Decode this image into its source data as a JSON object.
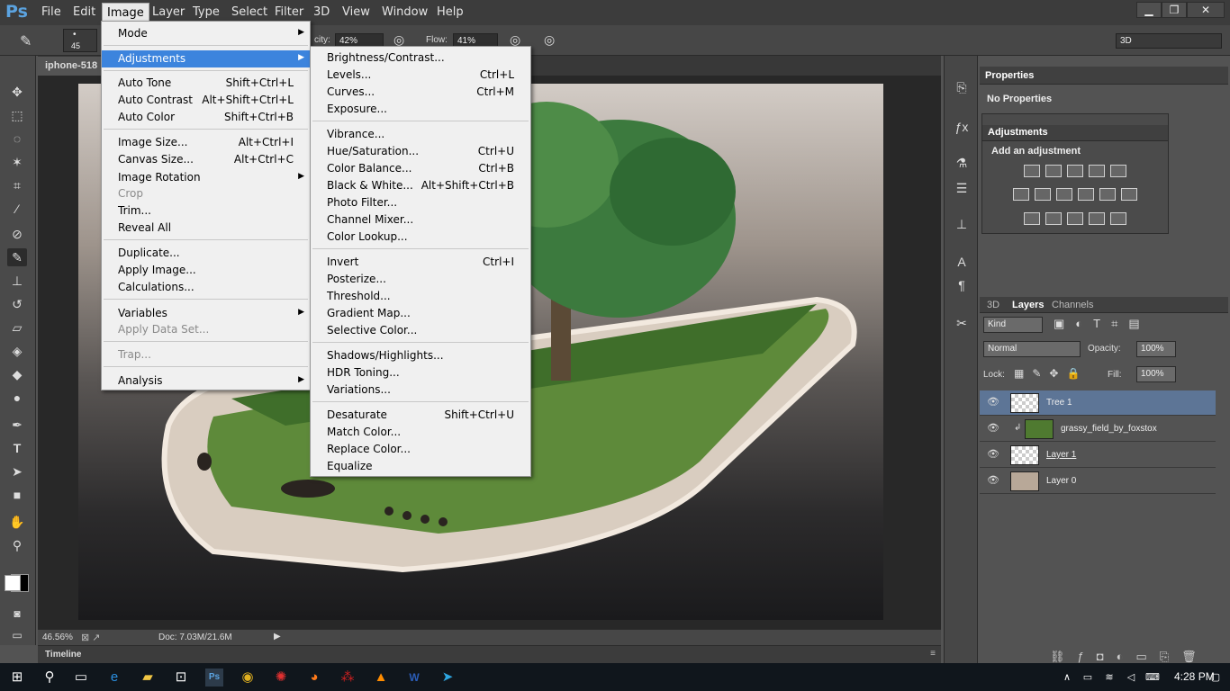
{
  "menubar": {
    "logo": "Ps",
    "items": [
      "File",
      "Edit",
      "Image",
      "Layer",
      "Type",
      "Select",
      "Filter",
      "3D",
      "View",
      "Window",
      "Help"
    ],
    "active": "Image"
  },
  "options": {
    "brush_size": "45",
    "opacity_label": "city:",
    "opacity_value": "42%",
    "flow_label": "Flow:",
    "flow_value": "41%",
    "workspace": "3D"
  },
  "document": {
    "tab_title": "iphone-518",
    "zoom": "46.56%",
    "doc_info": "Doc: 7.03M/21.6M"
  },
  "timeline": {
    "label": "Timeline"
  },
  "image_menu": {
    "items": [
      {
        "label": "Mode",
        "shortcut": "",
        "submenu": true
      },
      {
        "label": "Adjustments",
        "shortcut": "",
        "submenu": true,
        "highlighted": true
      },
      {
        "label": "Auto Tone",
        "shortcut": "Shift+Ctrl+L"
      },
      {
        "label": "Auto Contrast",
        "shortcut": "Alt+Shift+Ctrl+L"
      },
      {
        "label": "Auto Color",
        "shortcut": "Shift+Ctrl+B"
      },
      {
        "label": "Image Size...",
        "shortcut": "Alt+Ctrl+I"
      },
      {
        "label": "Canvas Size...",
        "shortcut": "Alt+Ctrl+C"
      },
      {
        "label": "Image Rotation",
        "shortcut": "",
        "submenu": true
      },
      {
        "label": "Crop",
        "shortcut": "",
        "disabled": true
      },
      {
        "label": "Trim...",
        "shortcut": ""
      },
      {
        "label": "Reveal All",
        "shortcut": ""
      },
      {
        "label": "Duplicate...",
        "shortcut": ""
      },
      {
        "label": "Apply Image...",
        "shortcut": ""
      },
      {
        "label": "Calculations...",
        "shortcut": ""
      },
      {
        "label": "Variables",
        "shortcut": "",
        "submenu": true
      },
      {
        "label": "Apply Data Set...",
        "shortcut": "",
        "disabled": true
      },
      {
        "label": "Trap...",
        "shortcut": "",
        "disabled": true
      },
      {
        "label": "Analysis",
        "shortcut": "",
        "submenu": true
      }
    ]
  },
  "adjustments_menu": {
    "items": [
      {
        "label": "Brightness/Contrast...",
        "shortcut": ""
      },
      {
        "label": "Levels...",
        "shortcut": "Ctrl+L"
      },
      {
        "label": "Curves...",
        "shortcut": "Ctrl+M"
      },
      {
        "label": "Exposure...",
        "shortcut": ""
      },
      {
        "label": "Vibrance...",
        "shortcut": ""
      },
      {
        "label": "Hue/Saturation...",
        "shortcut": "Ctrl+U"
      },
      {
        "label": "Color Balance...",
        "shortcut": "Ctrl+B"
      },
      {
        "label": "Black & White...",
        "shortcut": "Alt+Shift+Ctrl+B"
      },
      {
        "label": "Photo Filter...",
        "shortcut": ""
      },
      {
        "label": "Channel Mixer...",
        "shortcut": ""
      },
      {
        "label": "Color Lookup...",
        "shortcut": ""
      },
      {
        "label": "Invert",
        "shortcut": "Ctrl+I"
      },
      {
        "label": "Posterize...",
        "shortcut": ""
      },
      {
        "label": "Threshold...",
        "shortcut": ""
      },
      {
        "label": "Gradient Map...",
        "shortcut": ""
      },
      {
        "label": "Selective Color...",
        "shortcut": ""
      },
      {
        "label": "Shadows/Highlights...",
        "shortcut": ""
      },
      {
        "label": "HDR Toning...",
        "shortcut": ""
      },
      {
        "label": "Variations...",
        "shortcut": ""
      },
      {
        "label": "Desaturate",
        "shortcut": "Shift+Ctrl+U"
      },
      {
        "label": "Match Color...",
        "shortcut": ""
      },
      {
        "label": "Replace Color...",
        "shortcut": ""
      },
      {
        "label": "Equalize",
        "shortcut": ""
      }
    ]
  },
  "properties": {
    "tab": "Properties",
    "text": "No Properties"
  },
  "adjustments_panel": {
    "tab": "Adjustments",
    "heading": "Add an adjustment"
  },
  "layers_panel": {
    "tabs": [
      "3D",
      "Layers",
      "Channels"
    ],
    "active_tab": "Layers",
    "filter": "Kind",
    "blend_mode": "Normal",
    "opacity_label": "Opacity:",
    "opacity": "100%",
    "lock_label": "Lock:",
    "fill_label": "Fill:",
    "fill": "100%",
    "layers": [
      {
        "name": "Tree 1",
        "selected": true
      },
      {
        "name": "grassy_field_by_foxstox",
        "clipped": true
      },
      {
        "name": "Layer 1"
      },
      {
        "name": "Layer 0"
      }
    ]
  },
  "taskbar": {
    "time": "4:28 PM"
  }
}
